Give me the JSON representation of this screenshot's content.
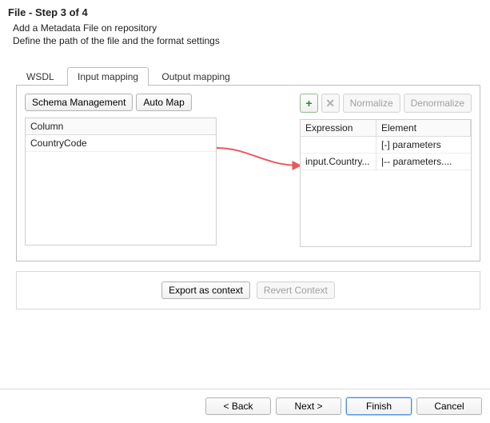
{
  "header": {
    "title": "File - Step 3 of 4",
    "subtitle_line1": "Add a Metadata File on repository",
    "subtitle_line2": "Define the path of the file and the format settings"
  },
  "tabs": {
    "wsdl": "WSDL",
    "input_mapping": "Input mapping",
    "output_mapping": "Output mapping"
  },
  "left_toolbar": {
    "schema_mgmt": "Schema Management",
    "auto_map": "Auto Map"
  },
  "left_grid": {
    "header": "Column",
    "rows": [
      "CountryCode"
    ]
  },
  "right_toolbar": {
    "add_icon": "+",
    "del_icon": "✕",
    "normalize": "Normalize",
    "denormalize": "Denormalize"
  },
  "right_grid": {
    "header_expr": "Expression",
    "header_elem": "Element",
    "rows": [
      {
        "expr": "",
        "elem": "[-] parameters"
      },
      {
        "expr": "input.Country...",
        "elem": "|-- parameters...."
      }
    ]
  },
  "context_bar": {
    "export": "Export as context",
    "revert": "Revert Context"
  },
  "footer": {
    "back": "< Back",
    "next": "Next >",
    "finish": "Finish",
    "cancel": "Cancel"
  }
}
